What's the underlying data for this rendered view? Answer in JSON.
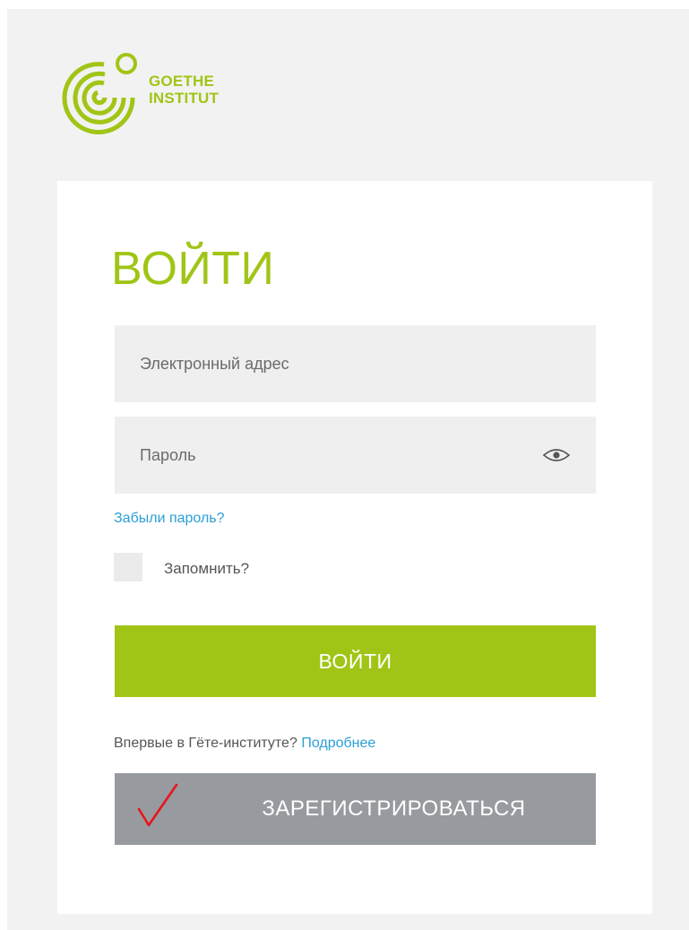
{
  "logo": {
    "line1": "GOETHE",
    "line2": "INSTITUT",
    "icon": "goethe-institut-logo"
  },
  "login": {
    "title": "ВОЙТИ",
    "email_placeholder": "Электронный адрес",
    "email_value": "",
    "password_placeholder": "Пароль",
    "password_value": "",
    "show_password_icon": "eye-icon",
    "forgot_password": "Забыли пароль?",
    "remember_label": "Запомнить?",
    "remember_checked": false,
    "submit_label": "ВОЙТИ"
  },
  "signup": {
    "prompt": "Впервые в Гёте-институте?",
    "more_link": "Подробнее",
    "register_label": "ЗАРЕГИСТРИРОВАТЬСЯ",
    "annotation_icon": "red-checkmark"
  },
  "colors": {
    "brand_green": "#a0c516",
    "link_blue": "#2b9fd6",
    "register_gray": "#979b9f",
    "input_bg": "#efefef",
    "page_bg": "#f2f2f2",
    "annotation_red": "#e8141c"
  }
}
